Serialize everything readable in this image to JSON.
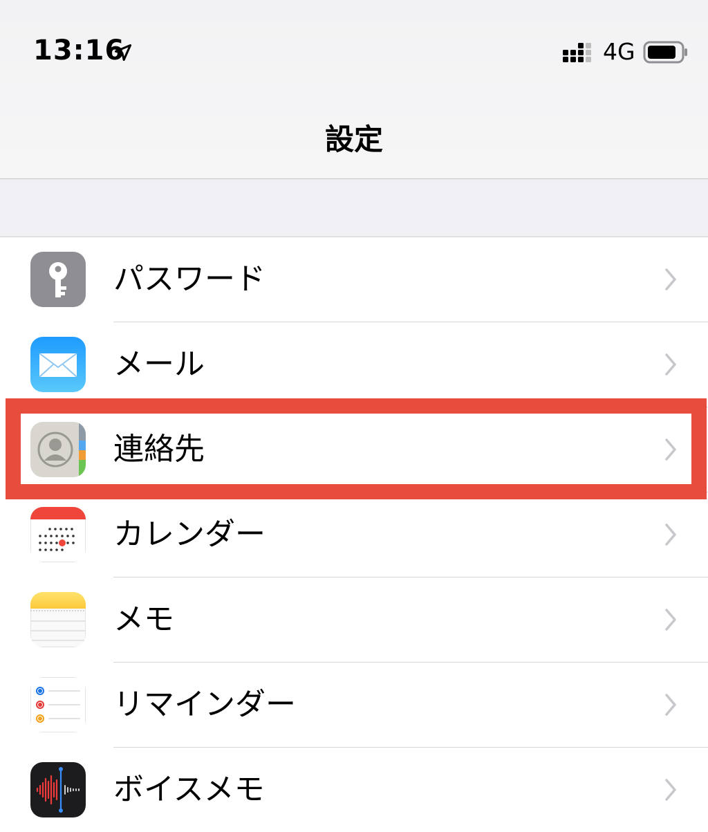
{
  "status_bar": {
    "time": "13:16",
    "network": "4G"
  },
  "nav": {
    "title": "設定"
  },
  "settings": {
    "items": [
      {
        "label": "パスワード",
        "icon": "key-icon"
      },
      {
        "label": "メール",
        "icon": "mail-icon"
      },
      {
        "label": "連絡先",
        "icon": "contacts-icon"
      },
      {
        "label": "カレンダー",
        "icon": "calendar-icon"
      },
      {
        "label": "メモ",
        "icon": "notes-icon"
      },
      {
        "label": "リマインダー",
        "icon": "reminders-icon"
      },
      {
        "label": "ボイスメモ",
        "icon": "voice-memos-icon"
      }
    ]
  },
  "colors": {
    "highlight": "#e84c3d",
    "chevron": "#c7c7cc",
    "separator": "#d6d6d9"
  }
}
